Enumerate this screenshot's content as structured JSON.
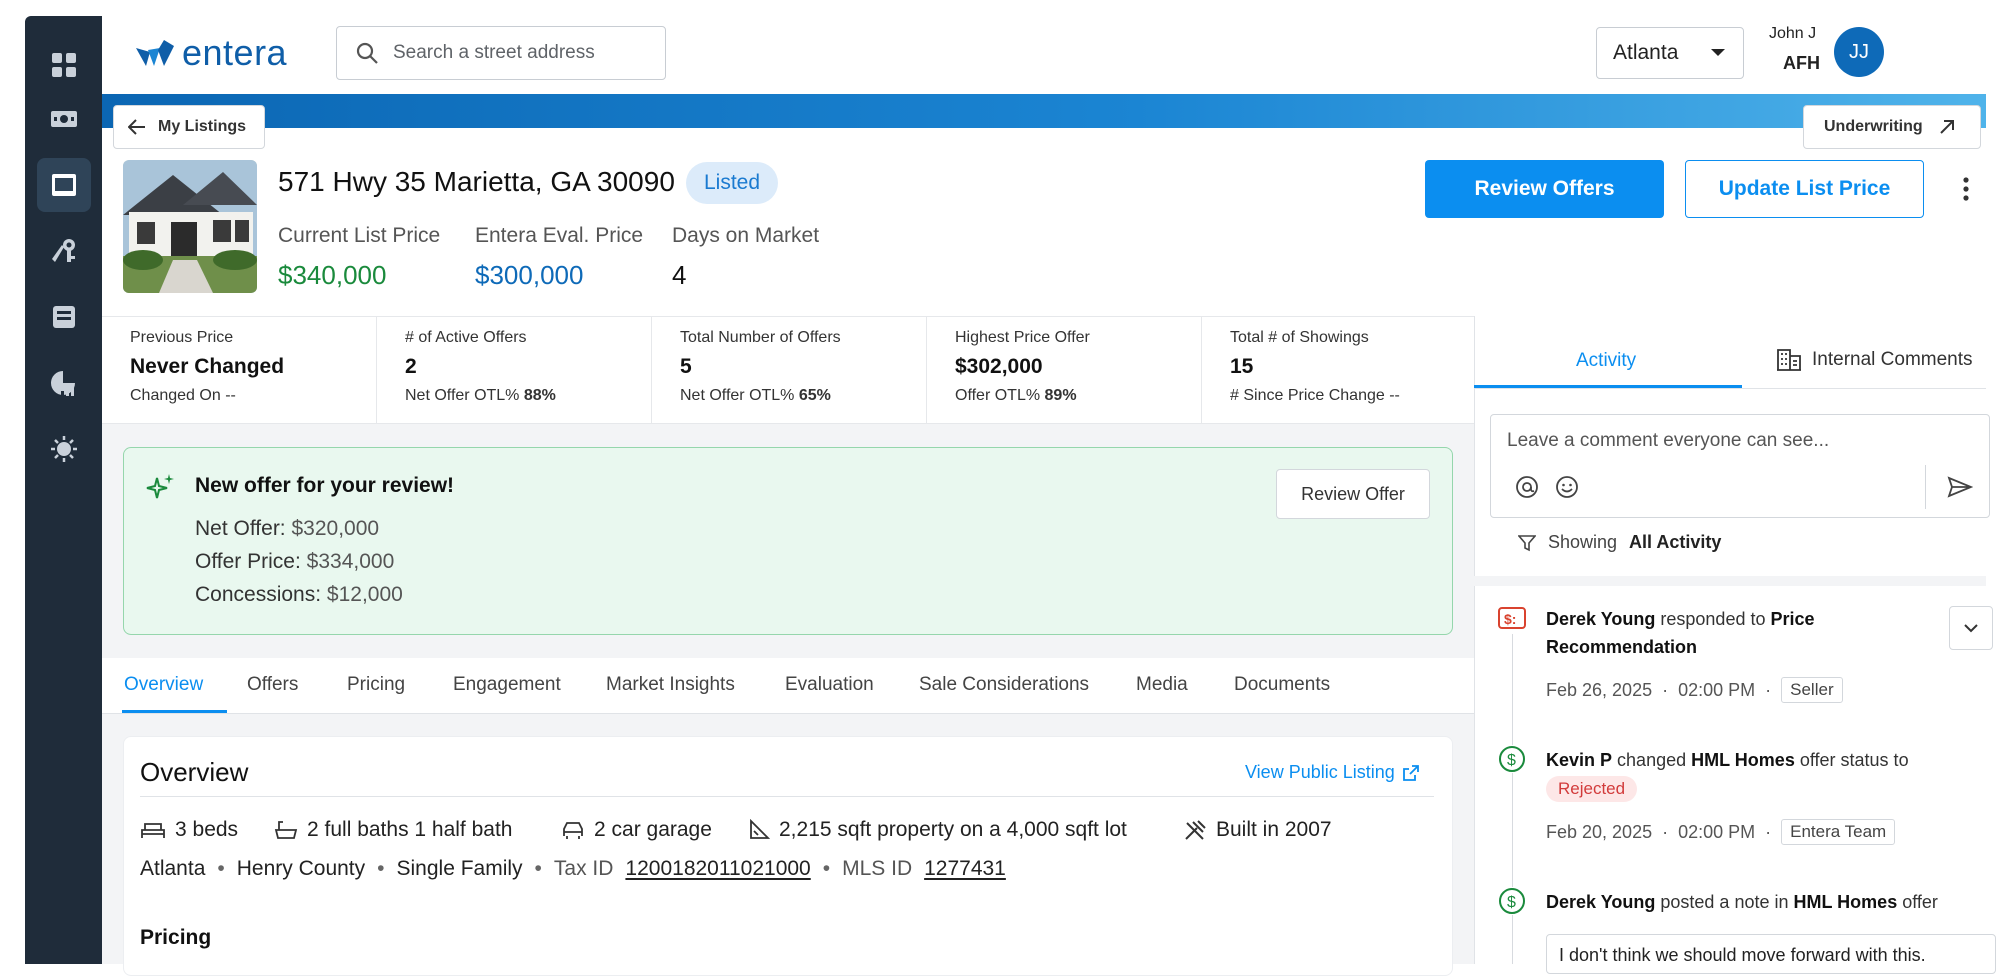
{
  "header": {
    "brand": "entera",
    "search_placeholder": "Search a street address",
    "city": "Atlanta",
    "user_name": "John J",
    "user_org": "AFH",
    "user_initials": "JJ"
  },
  "banner": {
    "back_label": "My Listings",
    "underwriting_label": "Underwriting"
  },
  "property": {
    "address": "571 Hwy 35 Marietta, GA 30090",
    "status": "Listed",
    "current_list_price_label": "Current List Price",
    "current_list_price": "$340,000",
    "eval_price_label": "Entera Eval. Price",
    "eval_price": "$300,000",
    "days_label": "Days on Market",
    "days": "4",
    "review_offers": "Review Offers",
    "update_list_price": "Update List Price"
  },
  "stats": [
    {
      "label": "Previous Price",
      "value": "Never Changed",
      "sub_label": "Changed On",
      "sub_value": "--"
    },
    {
      "label": "# of Active Offers",
      "value": "2",
      "sub_label": "Net Offer OTL%",
      "sub_value": "88%"
    },
    {
      "label": "Total Number of Offers",
      "value": "5",
      "sub_label": "Net Offer OTL%",
      "sub_value": "65%"
    },
    {
      "label": "Highest Price Offer",
      "value": "$302,000",
      "sub_label": "Offer OTL%",
      "sub_value": "89%"
    },
    {
      "label": "Total # of Showings",
      "value": "15",
      "sub_label": "# Since Price Change",
      "sub_value": "--"
    }
  ],
  "offer_alert": {
    "title": "New offer for your review!",
    "net_offer_label": "Net Offer:",
    "net_offer": "$320,000",
    "offer_price_label": "Offer Price:",
    "offer_price": "$334,000",
    "concessions_label": "Concessions:",
    "concessions": "$12,000",
    "button": "Review Offer"
  },
  "tabs": [
    "Overview",
    "Offers",
    "Pricing",
    "Engagement",
    "Market Insights",
    "Evaluation",
    "Sale Considerations",
    "Media",
    "Documents"
  ],
  "overview": {
    "title": "Overview",
    "public_link": "View Public Listing",
    "features": [
      "3 beds",
      "2 full baths 1 half bath",
      "2 car garage",
      "2,215 sqft property on a 4,000 sqft lot",
      "Built in 2007"
    ],
    "city": "Atlanta",
    "county": "Henry County",
    "type": "Single Family",
    "tax_id_label": "Tax ID",
    "tax_id": "1200182011021000",
    "mls_id_label": "MLS ID",
    "mls_id": "1277431",
    "pricing_heading": "Pricing"
  },
  "activity_panel": {
    "tab_activity": "Activity",
    "tab_comments": "Internal Comments",
    "comment_placeholder": "Leave a comment everyone can see...",
    "filter_prefix": "Showing",
    "filter_value": "All Activity",
    "items": [
      {
        "actor": "Derek Young",
        "action": "responded to",
        "target": "Price Recommendation",
        "date": "Feb 26, 2025",
        "time": "02:00 PM",
        "tag": "Seller"
      },
      {
        "actor": "Kevin P",
        "action": "changed",
        "target": "HML Homes",
        "action2": "offer status to",
        "status": "Rejected",
        "date": "Feb 20, 2025",
        "time": "02:00 PM",
        "tag": "Entera Team"
      },
      {
        "actor": "Derek Young",
        "action": "posted a note in",
        "target": "HML Homes",
        "action2": "offer",
        "note": "I don't think we should move forward with this."
      }
    ]
  },
  "colors": {
    "accent": "#0b8ef0",
    "green_price": "#1a8a3c",
    "blue_price": "#0e6ab8",
    "sidebar": "#1f2c3a"
  }
}
